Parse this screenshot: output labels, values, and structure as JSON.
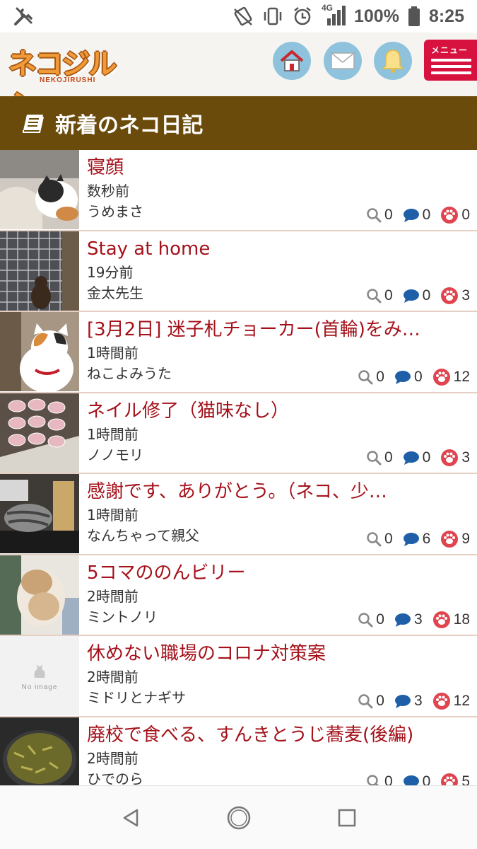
{
  "status_bar": {
    "network": "4G",
    "battery": "100%",
    "time": "8:25"
  },
  "header": {
    "logo_text": "ネコジルシ",
    "logo_sub": "NEKOJIRUSHI",
    "menu_label": "メニュー"
  },
  "section": {
    "title": "新着のネコ日記"
  },
  "colors": {
    "title_red": "#a5111a",
    "section_brown": "#6b4b0c",
    "menu_red": "#d8123f",
    "icon_blue": "#8fc3dd",
    "comment_blue": "#1e5fa8",
    "paw_red": "#e0454f"
  },
  "entries": [
    {
      "title": "寝顔",
      "time": "数秒前",
      "author": "うめまさ",
      "views": "0",
      "comments": "0",
      "likes": "0"
    },
    {
      "title": "Stay at home",
      "time": "19分前",
      "author": "金太先生",
      "views": "0",
      "comments": "0",
      "likes": "3"
    },
    {
      "title": "[3月2日] 迷子札チョーカー(首輪)をみ…",
      "time": "1時間前",
      "author": "ねこよみうた",
      "views": "0",
      "comments": "0",
      "likes": "12"
    },
    {
      "title": "ネイル修了（猫味なし）",
      "time": "1時間前",
      "author": "ノノモリ",
      "views": "0",
      "comments": "0",
      "likes": "3"
    },
    {
      "title": "感謝です、ありがとう。（ネコ、少…",
      "time": "1時間前",
      "author": "なんちゃって親父",
      "views": "0",
      "comments": "6",
      "likes": "9"
    },
    {
      "title": "5コマののんビリー",
      "time": "2時間前",
      "author": "ミントノリ",
      "views": "0",
      "comments": "3",
      "likes": "18"
    },
    {
      "title": "休めない職場のコロナ対策案",
      "time": "2時間前",
      "author": "ミドリとナギサ",
      "views": "0",
      "comments": "3",
      "likes": "12",
      "no_image_label": "No image"
    },
    {
      "title": "廃校で食べる、すんきとうじ蕎麦(後編)",
      "time": "2時間前",
      "author": "ひでのら",
      "views": "0",
      "comments": "0",
      "likes": "5"
    }
  ]
}
